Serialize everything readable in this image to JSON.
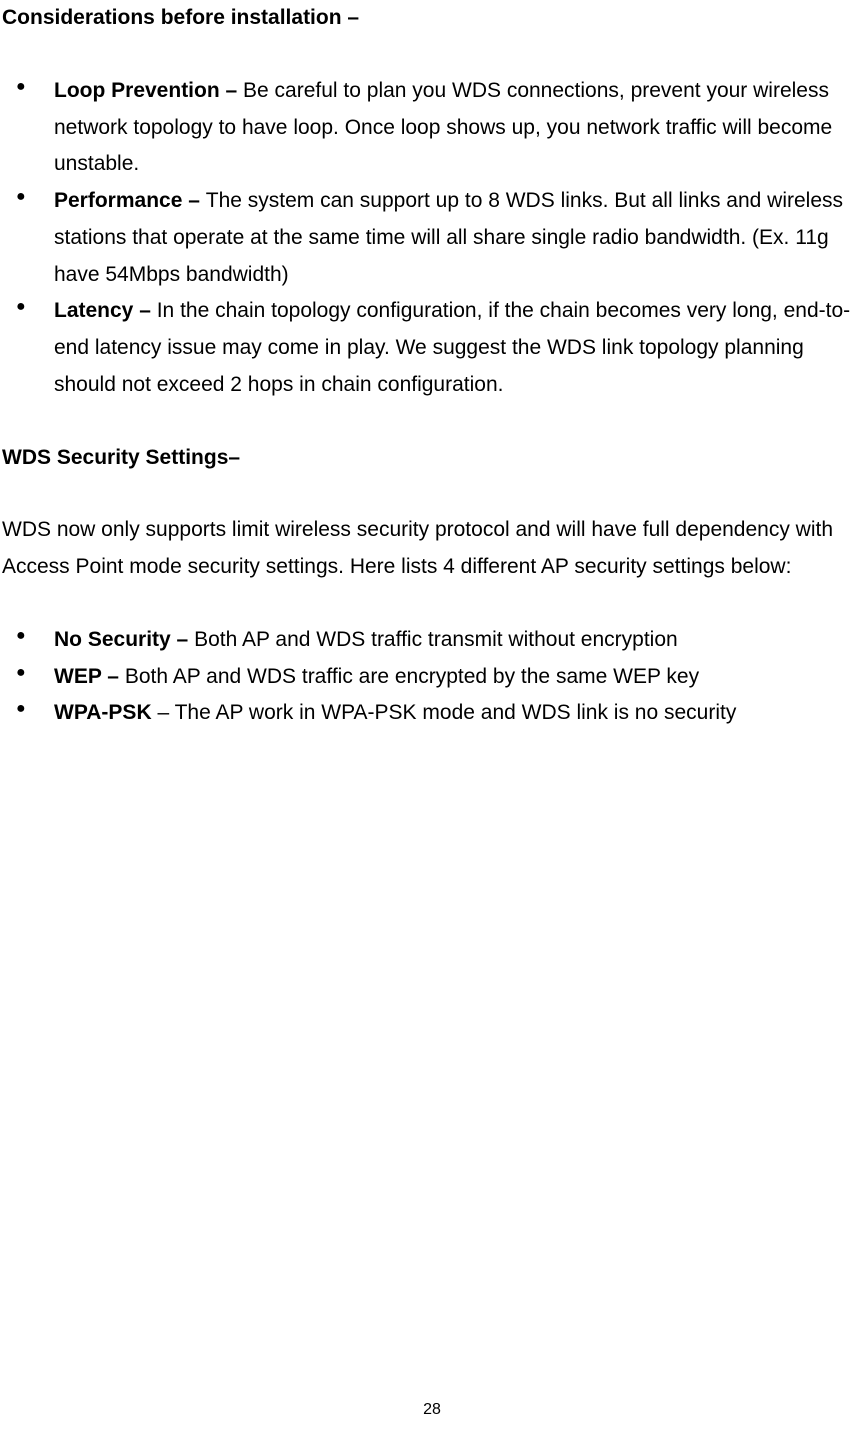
{
  "heading1": "Considerations before installation –",
  "list1": [
    {
      "label": "Loop Prevention – ",
      "text": "Be careful to plan you WDS connections, prevent your wireless network topology to have loop. Once loop shows up, you network traffic will become unstable."
    },
    {
      "label": "Performance – ",
      "text": "The system can support up to 8 WDS links. But all links and wireless stations that operate at the same time will all share single radio bandwidth. (Ex. 11g have 54Mbps bandwidth)"
    },
    {
      "label": "Latency – ",
      "text": "In the chain topology configuration, if the chain becomes very long, end-to-end latency issue may come in play. We suggest the WDS link topology planning should not exceed 2 hops in chain configuration."
    }
  ],
  "heading2": "WDS Security Settings–",
  "para1": "WDS now only supports limit wireless security protocol and will have full dependency with Access Point mode security settings. Here lists 4 different AP security settings below:",
  "list2": [
    {
      "label": "No Security – ",
      "text": "Both AP and WDS traffic transmit without encryption"
    },
    {
      "label": "WEP – ",
      "text": "Both AP and WDS traffic are encrypted by the same WEP key"
    },
    {
      "label": "WPA-PSK ",
      "text": "– The AP work in WPA-PSK mode and WDS link is no security"
    }
  ],
  "page_number": "28"
}
